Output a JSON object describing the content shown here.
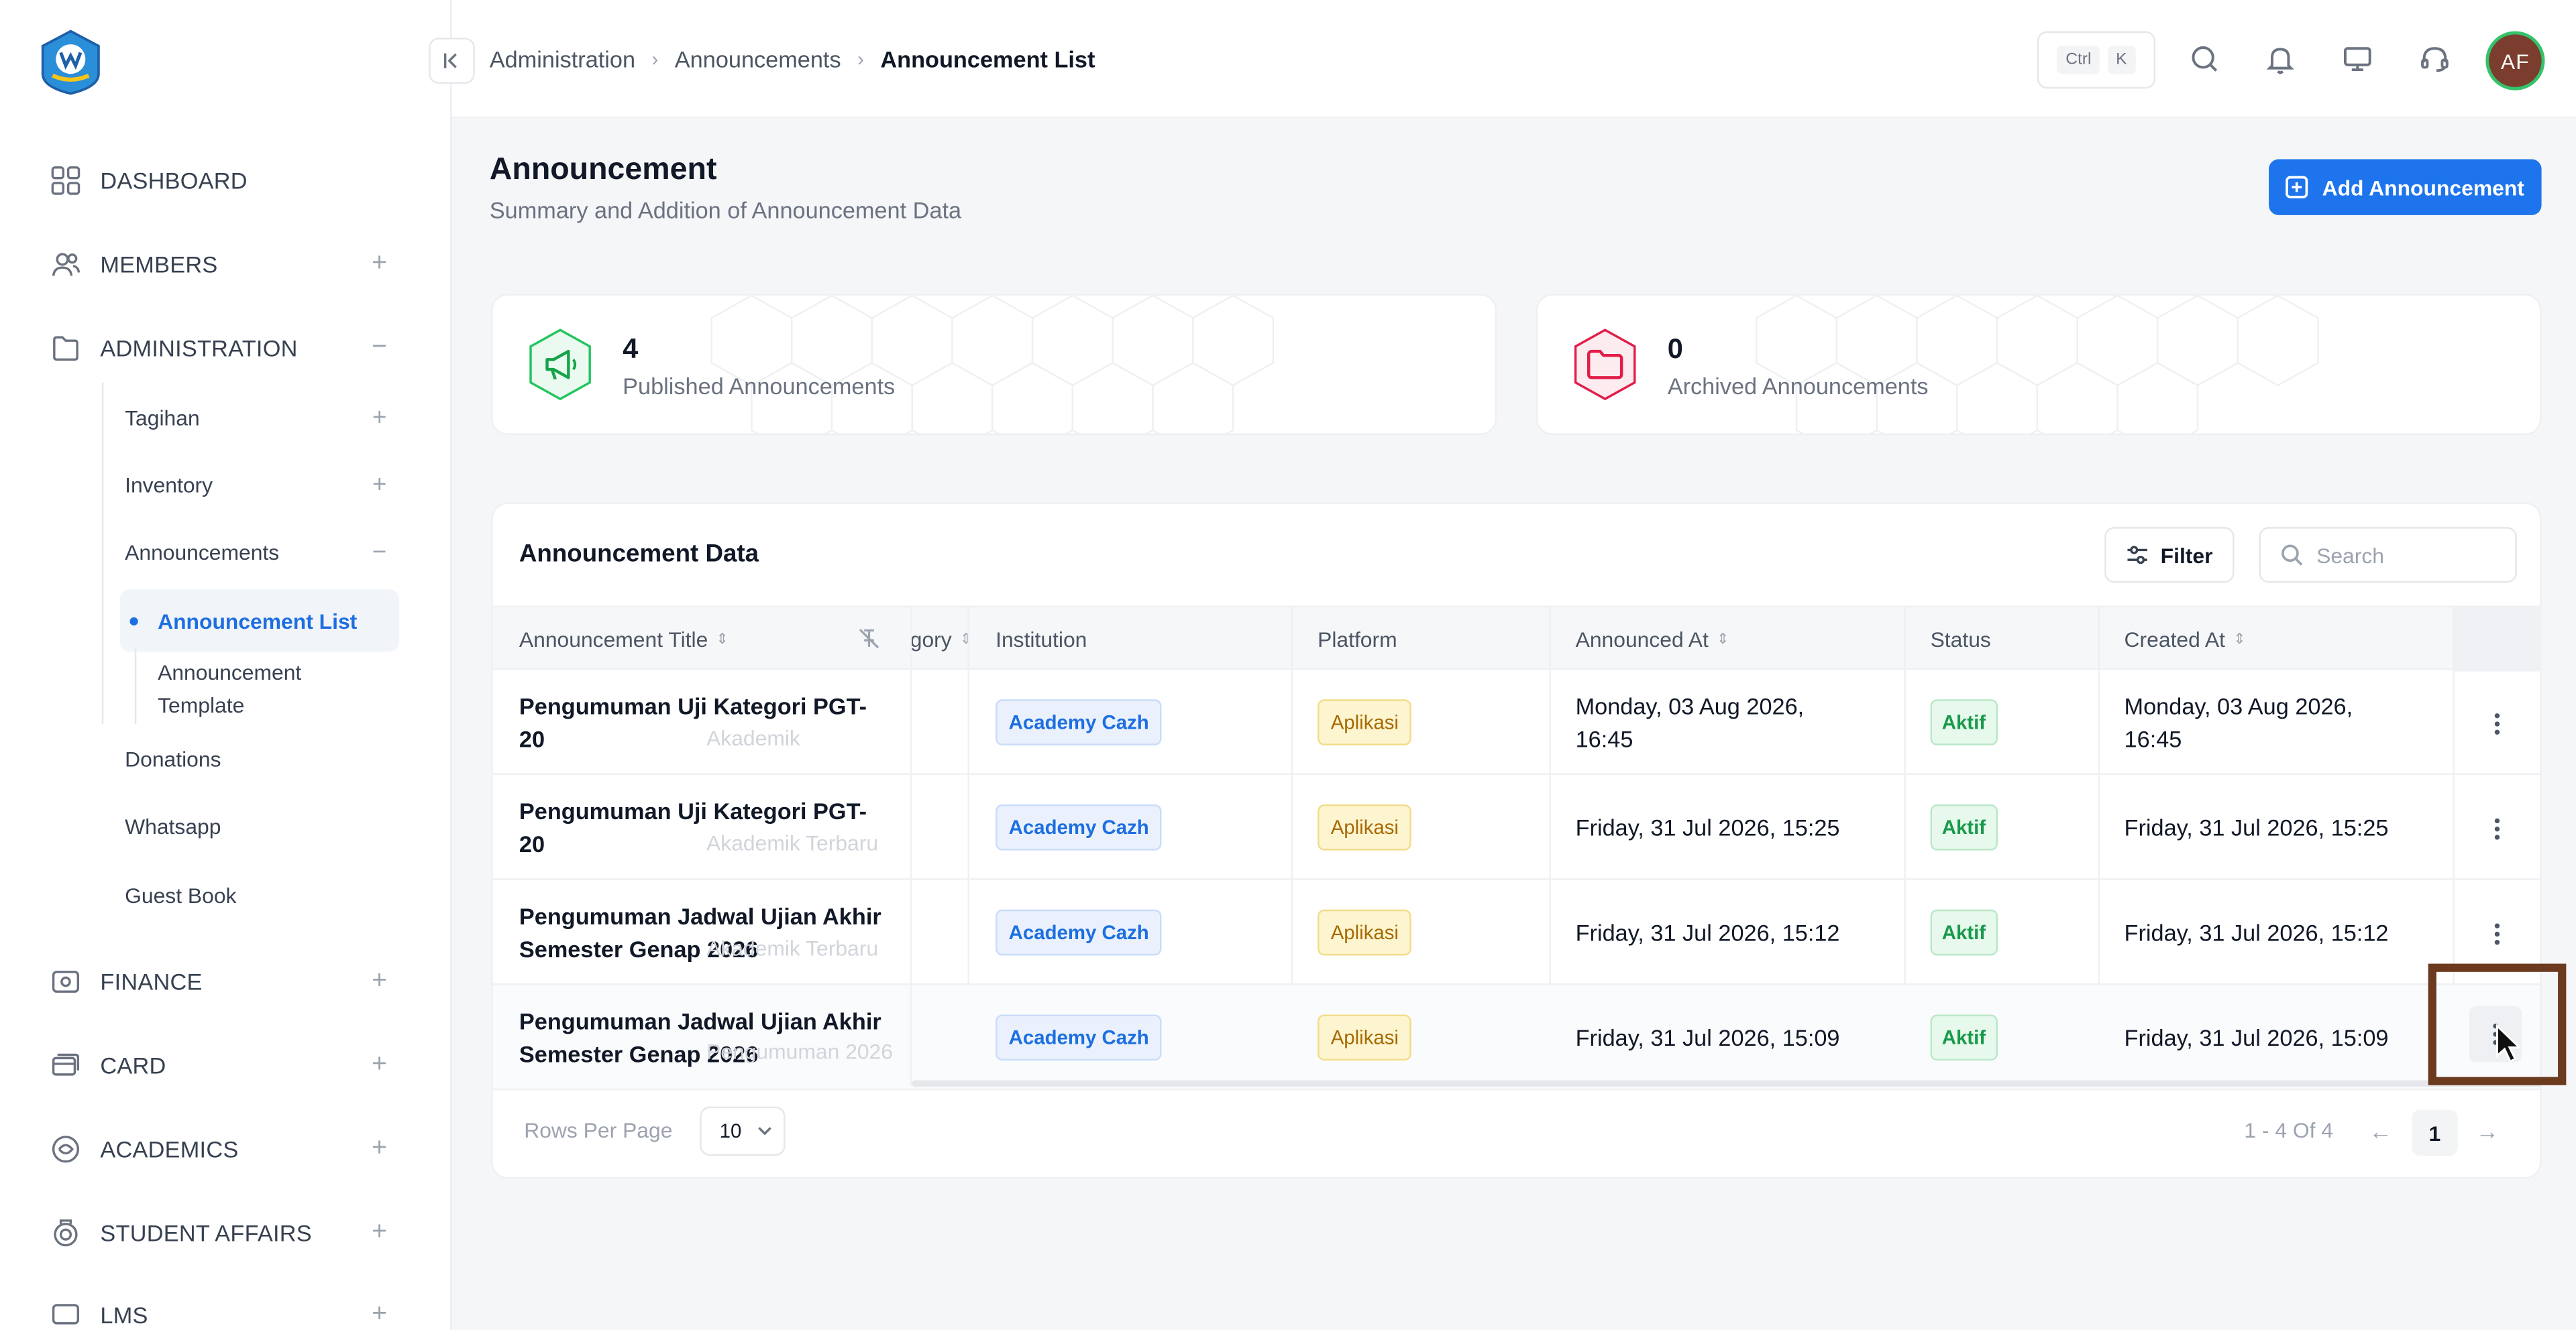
{
  "sidebar": {
    "items": [
      {
        "label": "DASHBOARD",
        "toggle": ""
      },
      {
        "label": "MEMBERS",
        "toggle": "+"
      },
      {
        "label": "ADMINISTRATION",
        "toggle": "−"
      },
      {
        "label": "FINANCE",
        "toggle": "+"
      },
      {
        "label": "CARD",
        "toggle": "+"
      },
      {
        "label": "ACADEMICS",
        "toggle": "+"
      },
      {
        "label": "STUDENT AFFAIRS",
        "toggle": "+"
      },
      {
        "label": "LMS",
        "toggle": "+"
      }
    ],
    "admin_children": [
      {
        "label": "Tagihan",
        "toggle": "+"
      },
      {
        "label": "Inventory",
        "toggle": "+"
      },
      {
        "label": "Announcements",
        "toggle": "−"
      },
      {
        "label": "Donations",
        "toggle": ""
      },
      {
        "label": "Whatsapp",
        "toggle": ""
      },
      {
        "label": "Guest Book",
        "toggle": ""
      }
    ],
    "announcement_children": [
      {
        "label": "Announcement List",
        "active": true
      },
      {
        "label": "Announcement Template",
        "active": false
      }
    ]
  },
  "topbar": {
    "breadcrumb": [
      "Administration",
      "Announcements",
      "Announcement List"
    ],
    "kbd": [
      "Ctrl",
      "K"
    ],
    "avatar_initials": "AF"
  },
  "page": {
    "title": "Announcement",
    "subtitle": "Summary and Addition of Announcement Data",
    "add_button": "Add Announcement"
  },
  "stats": [
    {
      "value": "4",
      "label": "Published Announcements",
      "color": "#22c55e"
    },
    {
      "value": "0",
      "label": "Archived Announcements",
      "color": "#e11d48"
    }
  ],
  "table": {
    "title": "Announcement Data",
    "filter_label": "Filter",
    "search_placeholder": "Search",
    "columns": [
      "Announcement Title",
      "Category",
      "Institution",
      "Platform",
      "Announced At",
      "Status",
      "Created At"
    ],
    "columns_partial_category": "gory",
    "rows": [
      {
        "title": "Pengumuman Uji Kategori PGT-20",
        "ghost": "Akademik",
        "institution": "Academy Cazh",
        "platform": "Aplikasi",
        "announced_at": "Monday, 03 Aug 2026, 16:45",
        "status": "Aktif",
        "created_at": "Monday, 03 Aug 2026, 16:45"
      },
      {
        "title": "Pengumuman Uji Kategori PGT-20",
        "ghost": "Akademik Terbaru",
        "institution": "Academy Cazh",
        "platform": "Aplikasi",
        "announced_at": "Friday, 31 Jul 2026, 15:25",
        "status": "Aktif",
        "created_at": "Friday, 31 Jul 2026, 15:25"
      },
      {
        "title": "Pengumuman Jadwal Ujian Akhir Semester Genap 2026",
        "ghost": "Akademik Terbaru",
        "institution": "Academy Cazh",
        "platform": "Aplikasi",
        "announced_at": "Friday, 31 Jul 2026, 15:12",
        "status": "Aktif",
        "created_at": "Friday, 31 Jul 2026, 15:12"
      },
      {
        "title": "Pengumuman Jadwal Ujian Akhir Semester Genap 2026",
        "ghost": "Pengumuman 2026",
        "institution": "Academy Cazh",
        "platform": "Aplikasi",
        "announced_at": "Friday, 31 Jul 2026, 15:09",
        "status": "Aktif",
        "created_at": "Friday, 31 Jul 2026, 15:09"
      }
    ],
    "rows_per_page_label": "Rows Per Page",
    "rows_per_page_value": "10",
    "range_text": "1 - 4 Of 4",
    "current_page": "1"
  },
  "colors": {
    "accent": "#1d74ec",
    "highlight_box": "#6b3a1f"
  }
}
